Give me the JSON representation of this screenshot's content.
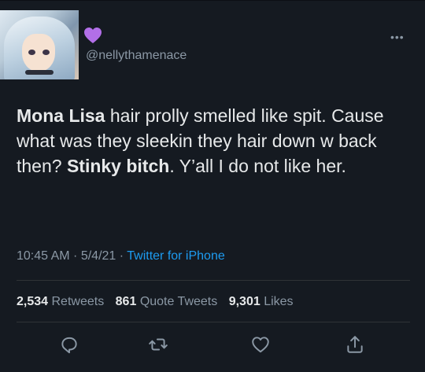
{
  "user": {
    "handle": "@nellythamenace",
    "name_emoji": "purple-heart-icon"
  },
  "tweet": {
    "segments": [
      {
        "text": "Mona Lisa",
        "bold": true
      },
      {
        "text": " hair prolly smelled like spit. Cause what was they sleekin they hair down w back then? ",
        "bold": false
      },
      {
        "text": "Stinky bitch",
        "bold": true
      },
      {
        "text": ". Y’all I do not like her.",
        "bold": false
      }
    ]
  },
  "meta": {
    "time": "10:45 AM",
    "sep1": " · ",
    "date": "5/4/21",
    "sep2": " · ",
    "source": "Twitter for iPhone"
  },
  "stats": {
    "retweets_count": "2,534",
    "retweets_label": "Retweets",
    "quotes_count": "861",
    "quotes_label": "Quote Tweets",
    "likes_count": "9,301",
    "likes_label": "Likes"
  },
  "actions": [
    "reply-icon",
    "retweet-icon",
    "like-icon",
    "share-icon"
  ],
  "colors": {
    "background": "#151a21",
    "text": "#e7e9ea",
    "muted": "#8b98a5",
    "link": "#1d9bf0",
    "heart": "#b26fe8"
  }
}
